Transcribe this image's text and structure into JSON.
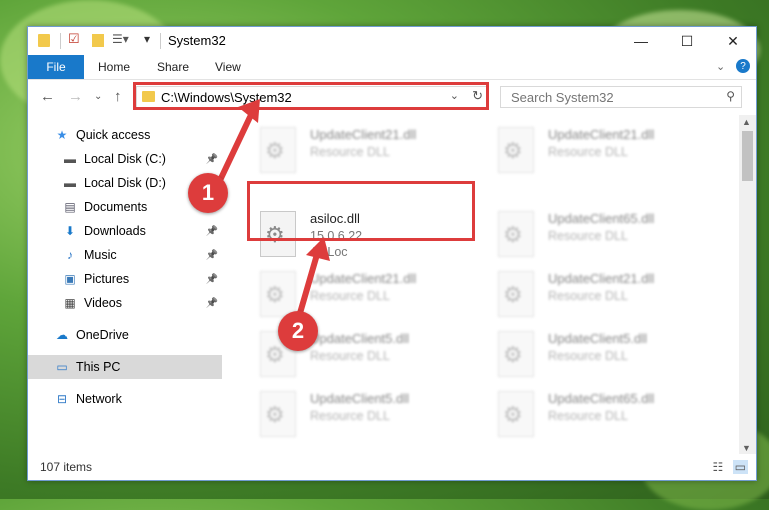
{
  "window": {
    "title": "System32",
    "minimize": "—",
    "maximize": "☐",
    "close": "✕"
  },
  "ribbon": {
    "file": "File",
    "home": "Home",
    "share": "Share",
    "view": "View"
  },
  "address": {
    "path": "C:\\Windows\\System32",
    "search_placeholder": "Search System32"
  },
  "nav": {
    "quick_access": "Quick access",
    "items": [
      {
        "label": "Local Disk (C:)",
        "icon": "drive-icon",
        "pinned": true
      },
      {
        "label": "Local Disk (D:)",
        "icon": "drive-icon",
        "pinned": false
      },
      {
        "label": "Documents",
        "icon": "documents-icon",
        "pinned": true
      },
      {
        "label": "Downloads",
        "icon": "downloads-icon",
        "pinned": true
      },
      {
        "label": "Music",
        "icon": "music-icon",
        "pinned": true
      },
      {
        "label": "Pictures",
        "icon": "pictures-icon",
        "pinned": true
      },
      {
        "label": "Videos",
        "icon": "videos-icon",
        "pinned": true
      }
    ],
    "onedrive": "OneDrive",
    "this_pc": "This PC",
    "network": "Network"
  },
  "files": {
    "highlighted": {
      "name": "asiloc.dll",
      "version": "15.0.6.22",
      "desc": "AsiLoc"
    },
    "left_col": [
      {
        "name": "UpdateClient21.dll",
        "desc": "Resource DLL"
      },
      {
        "name": "UpdateClient21.dll",
        "desc": "Resource DLL"
      },
      {
        "name": "UpdateClient5.dll",
        "desc": "Resource DLL"
      },
      {
        "name": "UpdateClient5.dll",
        "desc": "Resource DLL"
      }
    ],
    "right_col": [
      {
        "name": "UpdateClient21.dll",
        "desc": "Resource DLL"
      },
      {
        "name": "UpdateClient65.dll",
        "desc": "Resource DLL"
      },
      {
        "name": "UpdateClient21.dll",
        "desc": "Resource DLL"
      },
      {
        "name": "UpdateClient5.dll",
        "desc": "Resource DLL"
      },
      {
        "name": "UpdateClient65.dll",
        "desc": "Resource DLL"
      }
    ]
  },
  "status": {
    "count": "107 items"
  },
  "callouts": {
    "one": "1",
    "two": "2"
  },
  "colors": {
    "accent": "#1979ca",
    "annotation": "#dd3c3c"
  }
}
